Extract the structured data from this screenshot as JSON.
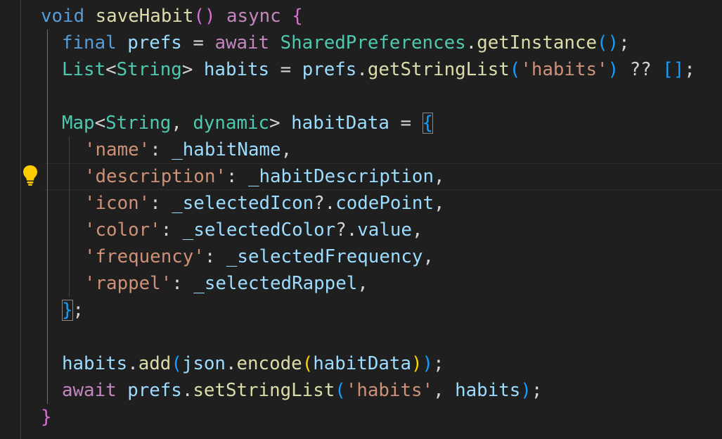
{
  "editor": {
    "language": "dart",
    "colors": {
      "background": "#1f1f1f",
      "keyword": "#569cd6",
      "control": "#c586c0",
      "function": "#dcdcaa",
      "variable": "#9cdcfe",
      "type": "#4ec9b0",
      "string": "#ce9178",
      "bracket_1": "#ffd700",
      "bracket_2": "#da70d6",
      "bracket_3": "#179fff",
      "lightbulb": "#ffcc00"
    },
    "lightbulb_icon": "lightbulb-icon",
    "lines": [
      {
        "tokens": [
          {
            "t": "void",
            "c": "kw"
          },
          {
            "t": " ",
            "c": "pun"
          },
          {
            "t": "saveHabit",
            "c": "fn"
          },
          {
            "t": "()",
            "c": "b2"
          },
          {
            "t": " ",
            "c": "pun"
          },
          {
            "t": "async",
            "c": "ctl"
          },
          {
            "t": " ",
            "c": "pun"
          },
          {
            "t": "{",
            "c": "b2"
          }
        ]
      },
      {
        "tokens": [
          {
            "t": "final",
            "c": "kw"
          },
          {
            "t": " ",
            "c": "pun"
          },
          {
            "t": "prefs",
            "c": "var"
          },
          {
            "t": " = ",
            "c": "pun"
          },
          {
            "t": "await",
            "c": "ctl"
          },
          {
            "t": " ",
            "c": "pun"
          },
          {
            "t": "SharedPreferences",
            "c": "type"
          },
          {
            "t": ".",
            "c": "pun"
          },
          {
            "t": "getInstance",
            "c": "fn"
          },
          {
            "t": "()",
            "c": "b3"
          },
          {
            "t": ";",
            "c": "pun"
          }
        ]
      },
      {
        "tokens": [
          {
            "t": "List",
            "c": "type"
          },
          {
            "t": "<",
            "c": "pun"
          },
          {
            "t": "String",
            "c": "type"
          },
          {
            "t": ">",
            "c": "pun"
          },
          {
            "t": " ",
            "c": "pun"
          },
          {
            "t": "habits",
            "c": "var"
          },
          {
            "t": " = ",
            "c": "pun"
          },
          {
            "t": "prefs",
            "c": "var"
          },
          {
            "t": ".",
            "c": "pun"
          },
          {
            "t": "getStringList",
            "c": "fn"
          },
          {
            "t": "(",
            "c": "b3"
          },
          {
            "t": "'habits'",
            "c": "str"
          },
          {
            "t": ")",
            "c": "b3"
          },
          {
            "t": " ?? ",
            "c": "pun"
          },
          {
            "t": "[]",
            "c": "b3"
          },
          {
            "t": ";",
            "c": "pun"
          }
        ]
      },
      {
        "tokens": []
      },
      {
        "tokens": [
          {
            "t": "Map",
            "c": "type"
          },
          {
            "t": "<",
            "c": "pun"
          },
          {
            "t": "String",
            "c": "type"
          },
          {
            "t": ", ",
            "c": "pun"
          },
          {
            "t": "dynamic",
            "c": "type"
          },
          {
            "t": ">",
            "c": "pun"
          },
          {
            "t": " ",
            "c": "pun"
          },
          {
            "t": "habitData",
            "c": "var"
          },
          {
            "t": " = ",
            "c": "pun"
          },
          {
            "t": "{",
            "c": "b3",
            "m": true
          }
        ]
      },
      {
        "tokens": [
          {
            "t": "'name'",
            "c": "str"
          },
          {
            "t": ": ",
            "c": "pun"
          },
          {
            "t": "_habitName",
            "c": "var"
          },
          {
            "t": ",",
            "c": "pun"
          }
        ]
      },
      {
        "tokens": [
          {
            "t": "'description'",
            "c": "str"
          },
          {
            "t": ": ",
            "c": "pun"
          },
          {
            "t": "_habitDescription",
            "c": "var"
          },
          {
            "t": ",",
            "c": "pun"
          }
        ]
      },
      {
        "tokens": [
          {
            "t": "'icon'",
            "c": "str"
          },
          {
            "t": ": ",
            "c": "pun"
          },
          {
            "t": "_selectedIcon",
            "c": "var"
          },
          {
            "t": "?.",
            "c": "pun"
          },
          {
            "t": "codePoint",
            "c": "var"
          },
          {
            "t": ",",
            "c": "pun"
          }
        ]
      },
      {
        "tokens": [
          {
            "t": "'color'",
            "c": "str"
          },
          {
            "t": ": ",
            "c": "pun"
          },
          {
            "t": "_selectedColor",
            "c": "var"
          },
          {
            "t": "?.",
            "c": "pun"
          },
          {
            "t": "value",
            "c": "var"
          },
          {
            "t": ",",
            "c": "pun"
          }
        ]
      },
      {
        "tokens": [
          {
            "t": "'frequency'",
            "c": "str"
          },
          {
            "t": ": ",
            "c": "pun"
          },
          {
            "t": "_selectedFrequency",
            "c": "var"
          },
          {
            "t": ",",
            "c": "pun"
          }
        ]
      },
      {
        "tokens": [
          {
            "t": "'rappel'",
            "c": "str"
          },
          {
            "t": ": ",
            "c": "pun"
          },
          {
            "t": "_selectedRappel",
            "c": "var"
          },
          {
            "t": ",",
            "c": "pun"
          }
        ]
      },
      {
        "tokens": [
          {
            "t": "}",
            "c": "b3",
            "m": true
          },
          {
            "t": ";",
            "c": "pun"
          }
        ]
      },
      {
        "tokens": []
      },
      {
        "tokens": [
          {
            "t": "habits",
            "c": "var"
          },
          {
            "t": ".",
            "c": "pun"
          },
          {
            "t": "add",
            "c": "fn"
          },
          {
            "t": "(",
            "c": "b3"
          },
          {
            "t": "json",
            "c": "var"
          },
          {
            "t": ".",
            "c": "pun"
          },
          {
            "t": "encode",
            "c": "fn"
          },
          {
            "t": "(",
            "c": "b1"
          },
          {
            "t": "habitData",
            "c": "var"
          },
          {
            "t": ")",
            "c": "b1"
          },
          {
            "t": ")",
            "c": "b3"
          },
          {
            "t": ";",
            "c": "pun"
          }
        ]
      },
      {
        "tokens": [
          {
            "t": "await",
            "c": "ctl"
          },
          {
            "t": " ",
            "c": "pun"
          },
          {
            "t": "prefs",
            "c": "var"
          },
          {
            "t": ".",
            "c": "pun"
          },
          {
            "t": "setStringList",
            "c": "fn"
          },
          {
            "t": "(",
            "c": "b3"
          },
          {
            "t": "'habits'",
            "c": "str"
          },
          {
            "t": ", ",
            "c": "pun"
          },
          {
            "t": "habits",
            "c": "var"
          },
          {
            "t": ")",
            "c": "b3"
          },
          {
            "t": ";",
            "c": "pun"
          }
        ]
      },
      {
        "tokens": [
          {
            "t": "}",
            "c": "b2"
          }
        ]
      }
    ]
  }
}
